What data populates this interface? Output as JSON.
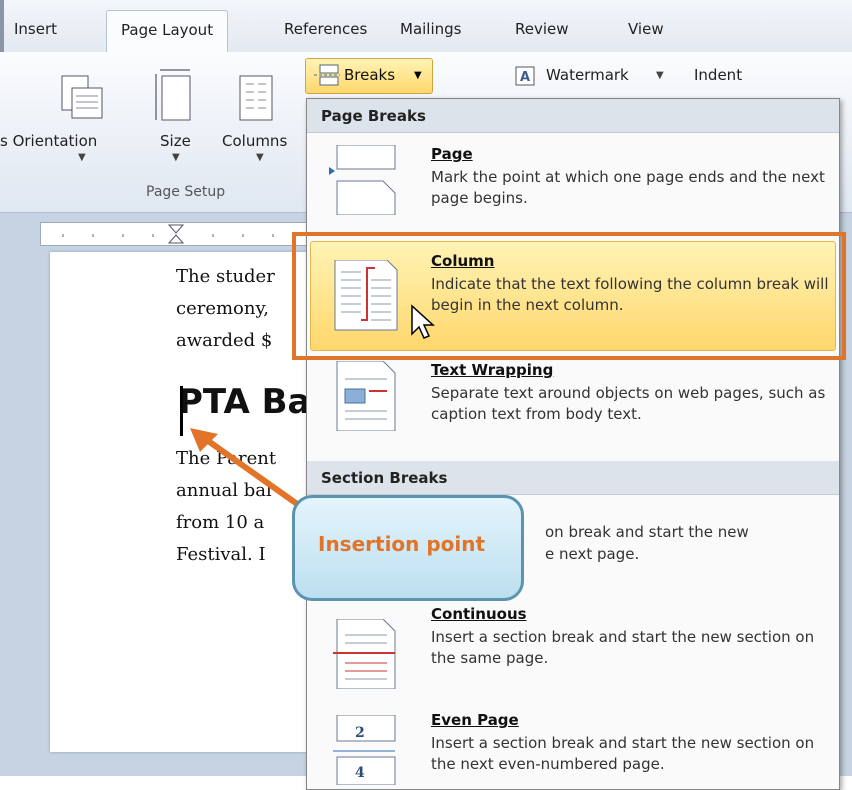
{
  "tabs": [
    "Insert",
    "Page Layout",
    "References",
    "Mailings",
    "Review",
    "View"
  ],
  "ribbon": {
    "orientation": "s Orientation",
    "size": "Size",
    "columns": "Columns",
    "breaks": "Breaks",
    "watermark": "Watermark",
    "indent": "Indent",
    "group_label": "Page Setup"
  },
  "document": {
    "lines": [
      "The studer",
      "ceremony,",
      "awarded $"
    ],
    "heading": "PTA Ba",
    "lines2": [
      "The Parent",
      "annual bal",
      "from 10 a",
      "Festival. I"
    ]
  },
  "menu": {
    "page_breaks_header": "Page Breaks",
    "section_breaks_header": "Section Breaks",
    "items": [
      {
        "title": "Page",
        "desc": "Mark the point at which one page ends and the next page begins."
      },
      {
        "title": "Column",
        "desc": "Indicate that the text following the column break will begin in the next column."
      },
      {
        "title": "Text Wrapping",
        "desc": "Separate text around objects on web pages, such as caption text from body text."
      },
      {
        "title": "",
        "desc": "on break and start the new",
        "desc2": "e next page."
      },
      {
        "title": "Continuous",
        "desc": "Insert a section break and start the new section on the same page."
      },
      {
        "title": "Even Page",
        "desc": "Insert a section break and start the new section on the next even-numbered page."
      }
    ]
  },
  "callout": {
    "text": "Insertion point"
  },
  "colors": {
    "accent": "#e2742a",
    "highlight": "#ffd76c"
  }
}
